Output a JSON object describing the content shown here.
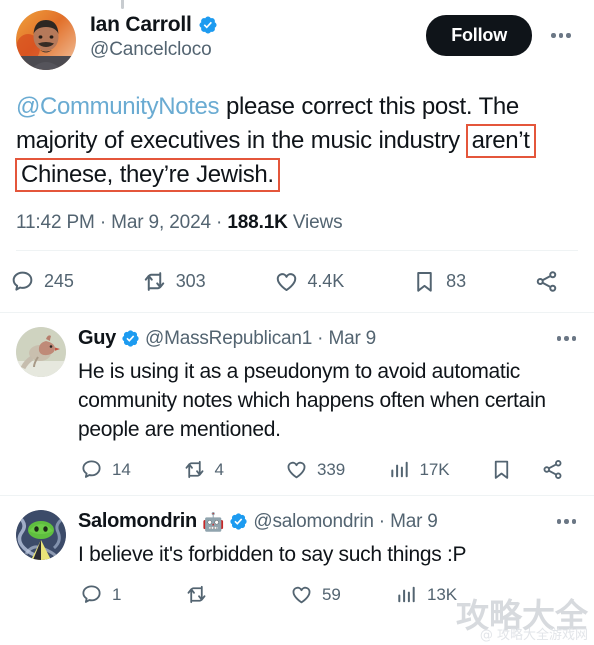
{
  "main_post": {
    "display_name": "Ian Carroll",
    "verified": true,
    "handle": "@Cancelcloco",
    "follow_label": "Follow",
    "more_icon": "ellipsis-icon",
    "text_mention": "@CommunityNotes",
    "text_part1": " please correct this post. The majority of executives in the music industry ",
    "highlight1": "aren’t",
    "highlight2": "Chinese, they’re Jewish.",
    "timestamp_time": "11:42 PM",
    "timestamp_sep1": " · ",
    "timestamp_date": "Mar 9, 2024",
    "timestamp_sep2": " · ",
    "views_count": "188.1K",
    "views_label": " Views",
    "actions": {
      "reply_count": "245",
      "repost_count": "303",
      "like_count": "4.4K",
      "bookmark_count": "83",
      "share_label": ""
    }
  },
  "replies": [
    {
      "display_name": "Guy",
      "emoji": "",
      "verified": true,
      "handle": "@MassRepublican1",
      "separator": "·",
      "date": "Mar 9",
      "text": "He is using it as a pseudonym to avoid automatic community notes which happens often when certain people are mentioned.",
      "actions": {
        "reply_count": "14",
        "repost_count": "4",
        "like_count": "339",
        "views_count": "17K"
      }
    },
    {
      "display_name": "Salomondrin",
      "emoji": "🤖",
      "verified": true,
      "handle": "@salomondrin",
      "separator": "·",
      "date": "Mar 9",
      "text": "I believe it's forbidden to say such things :P",
      "actions": {
        "reply_count": "1",
        "repost_count": "",
        "like_count": "59",
        "views_count": "13K"
      }
    }
  ],
  "watermark": {
    "main": "攻略大全",
    "sub": "@ 攻略大全游戏网"
  },
  "colors": {
    "verified_blue": "#1d9bf0",
    "mention_blue": "#6aabd2",
    "highlight_red": "#e4563b",
    "text_primary": "#0f1419",
    "text_secondary": "#536471",
    "divider": "#eff3f4",
    "follow_bg": "#0f1419"
  }
}
